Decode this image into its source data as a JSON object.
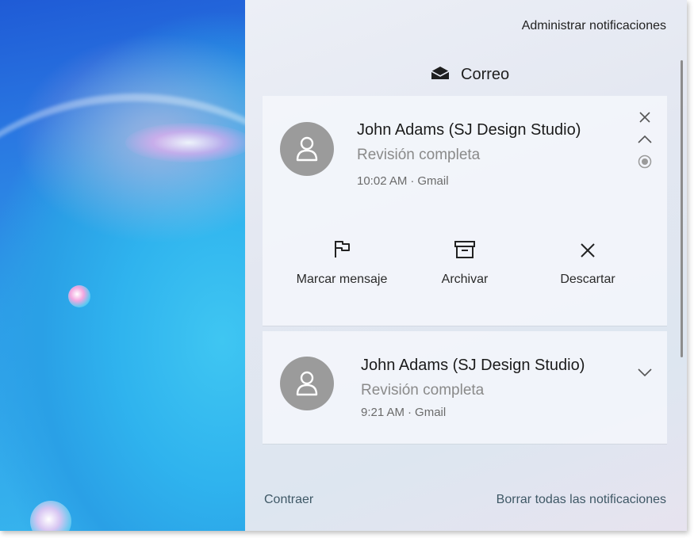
{
  "panel": {
    "manage_label": "Administrar notificaciones",
    "group_title": "Correo",
    "group_icon": "mail-envelope-icon",
    "collapse_label": "Contraer",
    "clear_all_label": "Borrar todas las notificaciones"
  },
  "notifications": [
    {
      "sender": "John Adams (SJ Design Studio)",
      "subject": "Revisión completa",
      "time": "10:02 AM",
      "source": "Gmail",
      "state": "expanded",
      "actions": [
        {
          "label": "Marcar mensaje",
          "icon": "flag-icon"
        },
        {
          "label": "Archivar",
          "icon": "archive-icon"
        },
        {
          "label": "Descartar",
          "icon": "close-icon"
        }
      ]
    },
    {
      "sender": "John Adams (SJ Design Studio)",
      "subject": "Revisión completa",
      "time": "9:21 AM",
      "source": "Gmail",
      "state": "collapsed"
    }
  ],
  "colors": {
    "panel_bg": "#e4e8f2",
    "avatar_bg": "#9b9b9b",
    "secondary_text": "#8a8a8a",
    "footer_link": "#3f5866"
  }
}
